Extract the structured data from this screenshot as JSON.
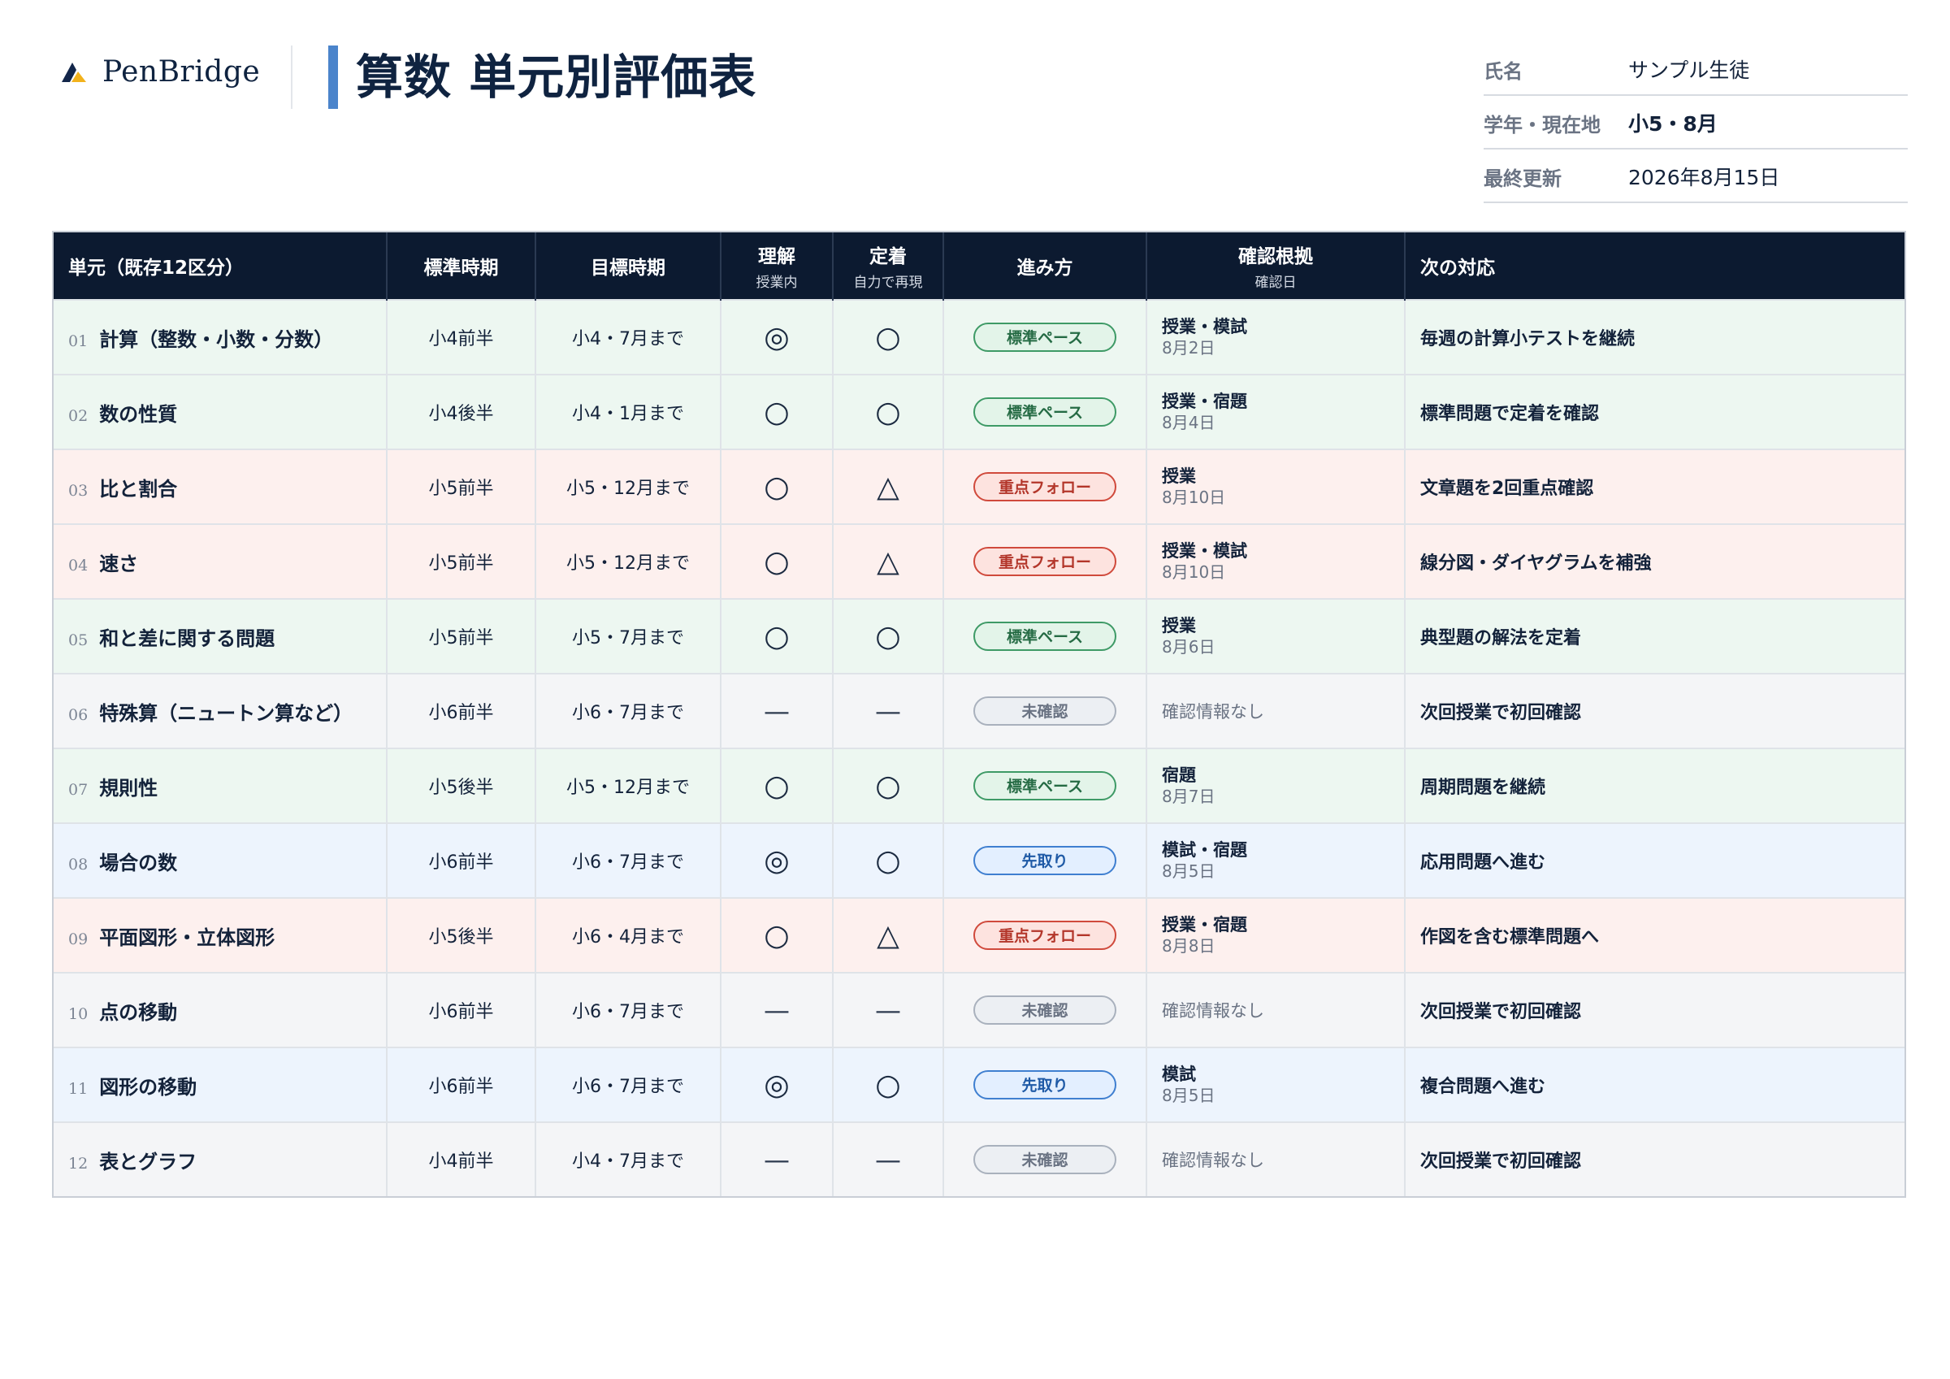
{
  "brand": {
    "name": "PenBridge",
    "logo_icon": "penbridge-chevron-logo"
  },
  "title": "算数 単元別評価表",
  "meta": [
    {
      "label": "氏名",
      "value": "サンプル生徒",
      "bold": false
    },
    {
      "label": "学年・現在地",
      "value": "小5・8月",
      "bold": true
    },
    {
      "label": "最終更新",
      "value": "2026年8月15日",
      "bold": false
    }
  ],
  "table": {
    "headers": {
      "unit": "単元（既存12区分）",
      "standard": "標準時期",
      "target": "目標時期",
      "understanding": "理解",
      "understanding_sub": "授業内",
      "retention": "定着",
      "retention_sub": "自力で再現",
      "pace": "進み方",
      "evidence": "確認根拠",
      "evidence_sub": "確認日",
      "next": "次の対応"
    },
    "rows": [
      {
        "no": "01",
        "name": "計算（整数・小数・分数）",
        "standard": "小4前半",
        "target": "小4・7月まで",
        "understanding": "◎",
        "retention": "○",
        "pace": "標準ペース",
        "pace_type": "standard",
        "evidence": "授業・模試",
        "date": "8月2日",
        "next": "毎週の計算小テストを継続",
        "tint": "green"
      },
      {
        "no": "02",
        "name": "数の性質",
        "standard": "小4後半",
        "target": "小4・1月まで",
        "understanding": "○",
        "retention": "○",
        "pace": "標準ペース",
        "pace_type": "standard",
        "evidence": "授業・宿題",
        "date": "8月4日",
        "next": "標準問題で定着を確認",
        "tint": "green"
      },
      {
        "no": "03",
        "name": "比と割合",
        "standard": "小5前半",
        "target": "小5・12月まで",
        "understanding": "○",
        "retention": "△",
        "pace": "重点フォロー",
        "pace_type": "focus",
        "evidence": "授業",
        "date": "8月10日",
        "next": "文章題を2回重点確認",
        "tint": "red"
      },
      {
        "no": "04",
        "name": "速さ",
        "standard": "小5前半",
        "target": "小5・12月まで",
        "understanding": "○",
        "retention": "△",
        "pace": "重点フォロー",
        "pace_type": "focus",
        "evidence": "授業・模試",
        "date": "8月10日",
        "next": "線分図・ダイヤグラムを補強",
        "tint": "red"
      },
      {
        "no": "05",
        "name": "和と差に関する問題",
        "standard": "小5前半",
        "target": "小5・7月まで",
        "understanding": "○",
        "retention": "○",
        "pace": "標準ペース",
        "pace_type": "standard",
        "evidence": "授業",
        "date": "8月6日",
        "next": "典型題の解法を定着",
        "tint": "green"
      },
      {
        "no": "06",
        "name": "特殊算（ニュートン算など）",
        "standard": "小6前半",
        "target": "小6・7月まで",
        "understanding": "—",
        "retention": "—",
        "pace": "未確認",
        "pace_type": "unconfirmed",
        "evidence": "確認情報なし",
        "date": "",
        "next": "次回授業で初回確認",
        "tint": "gray"
      },
      {
        "no": "07",
        "name": "規則性",
        "standard": "小5後半",
        "target": "小5・12月まで",
        "understanding": "○",
        "retention": "○",
        "pace": "標準ペース",
        "pace_type": "standard",
        "evidence": "宿題",
        "date": "8月7日",
        "next": "周期問題を継続",
        "tint": "green"
      },
      {
        "no": "08",
        "name": "場合の数",
        "standard": "小6前半",
        "target": "小6・7月まで",
        "understanding": "◎",
        "retention": "○",
        "pace": "先取り",
        "pace_type": "ahead",
        "evidence": "模試・宿題",
        "date": "8月5日",
        "next": "応用問題へ進む",
        "tint": "blue"
      },
      {
        "no": "09",
        "name": "平面図形・立体図形",
        "standard": "小5後半",
        "target": "小6・4月まで",
        "understanding": "○",
        "retention": "△",
        "pace": "重点フォロー",
        "pace_type": "focus",
        "evidence": "授業・宿題",
        "date": "8月8日",
        "next": "作図を含む標準問題へ",
        "tint": "red"
      },
      {
        "no": "10",
        "name": "点の移動",
        "standard": "小6前半",
        "target": "小6・7月まで",
        "understanding": "—",
        "retention": "—",
        "pace": "未確認",
        "pace_type": "unconfirmed",
        "evidence": "確認情報なし",
        "date": "",
        "next": "次回授業で初回確認",
        "tint": "gray"
      },
      {
        "no": "11",
        "name": "図形の移動",
        "standard": "小6前半",
        "target": "小6・7月まで",
        "understanding": "◎",
        "retention": "○",
        "pace": "先取り",
        "pace_type": "ahead",
        "evidence": "模試",
        "date": "8月5日",
        "next": "複合問題へ進む",
        "tint": "blue"
      },
      {
        "no": "12",
        "name": "表とグラフ",
        "standard": "小4前半",
        "target": "小4・7月まで",
        "understanding": "—",
        "retention": "—",
        "pace": "未確認",
        "pace_type": "unconfirmed",
        "evidence": "確認情報なし",
        "date": "",
        "next": "次回授業で初回確認",
        "tint": "gray"
      }
    ]
  },
  "colors": {
    "header_bg": "#0c1a30",
    "title_accent": "#4b84cb",
    "standard_pace": "#3e9a66",
    "focus_follow": "#d04a3c",
    "unconfirmed": "#a9b1bd",
    "ahead": "#3f7fd0"
  }
}
